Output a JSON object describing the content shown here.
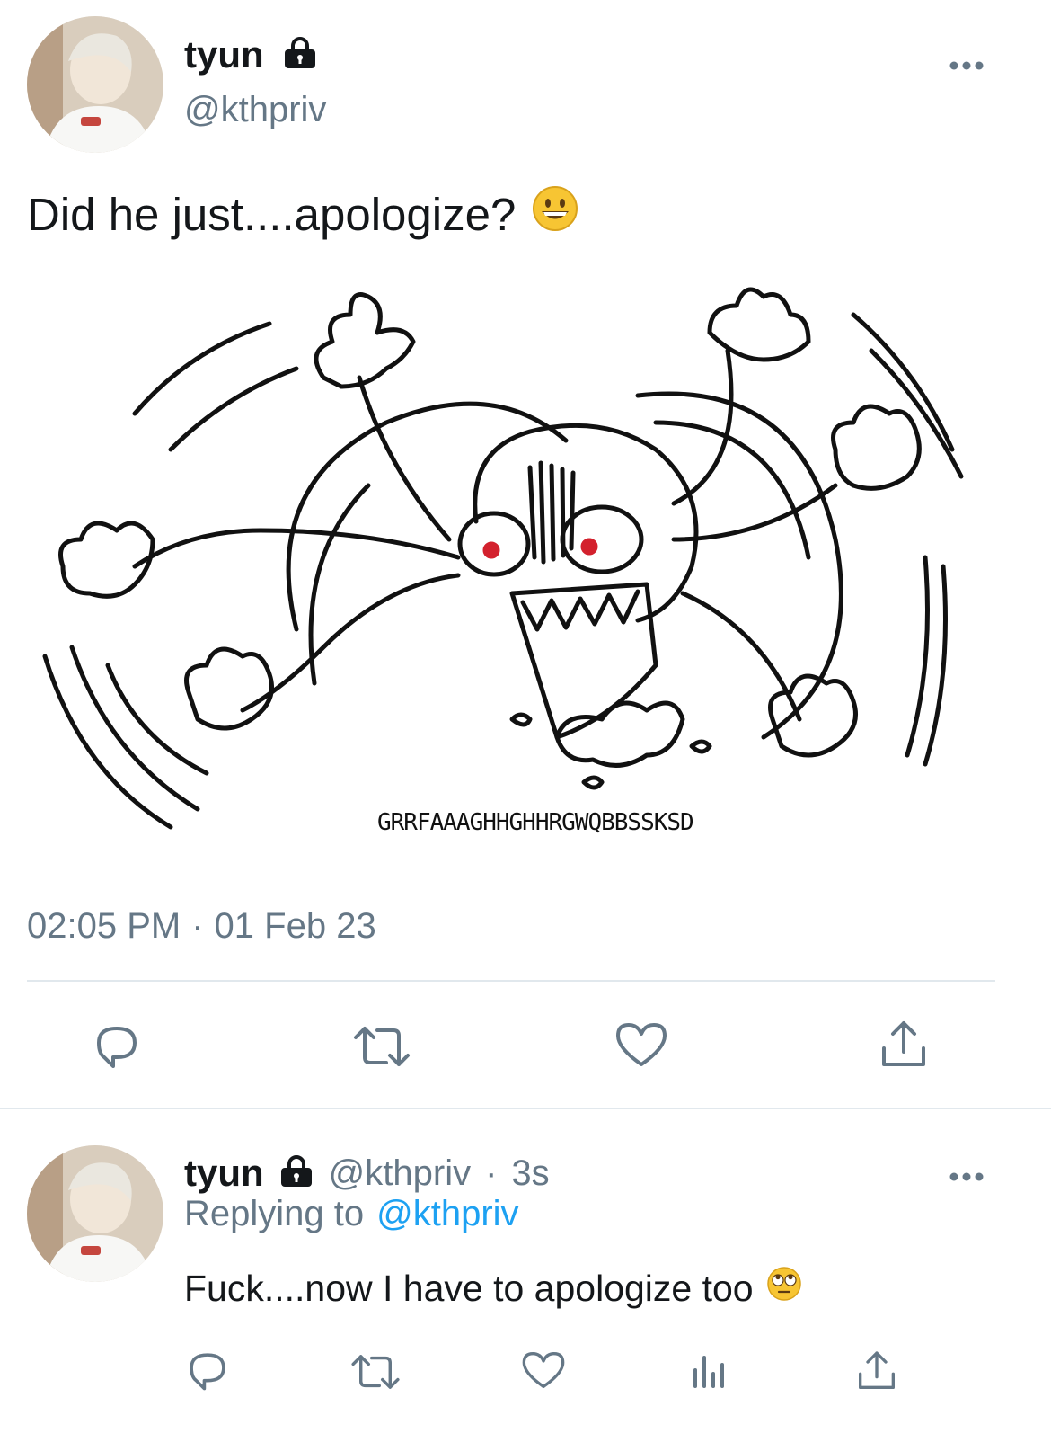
{
  "main_tweet": {
    "display_name": "tyun",
    "handle": "@kthpriv",
    "text": "Did he just....apologize?",
    "emoji": "grinning-face",
    "image_caption": "GRRFAAAGHHGHHRGWQBBSSKSD",
    "time": "02:05 PM",
    "separator": "·",
    "date": "01 Feb 23"
  },
  "reply_tweet": {
    "display_name": "tyun",
    "handle": "@kthpriv",
    "separator": "·",
    "age": "3s",
    "replying_prefix": "Replying to",
    "replying_handle": "@kthpriv",
    "text": "Fuck....now I have to apologize too",
    "emoji": "face-with-rolling-eyes"
  },
  "colors": {
    "text": "#14171a",
    "muted": "#657786",
    "link": "#1da1f2",
    "divider": "#e1e8ed"
  }
}
